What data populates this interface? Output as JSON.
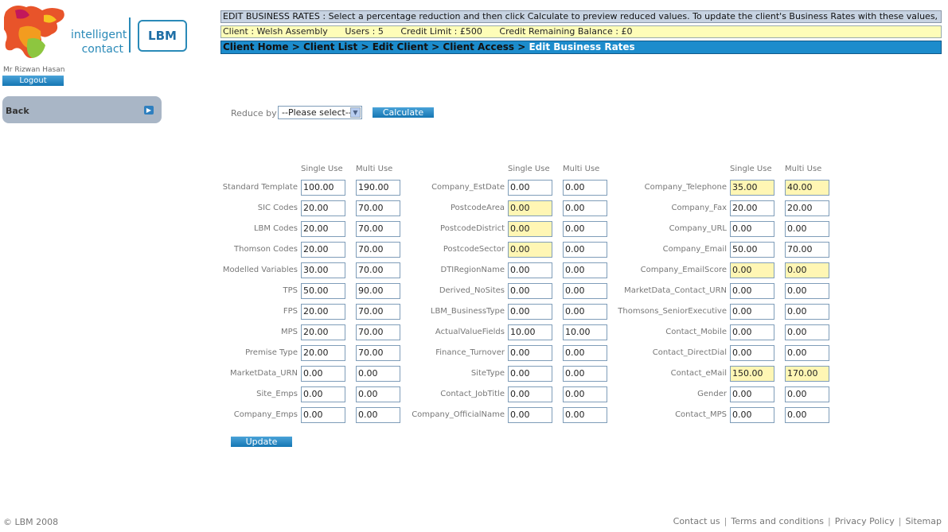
{
  "brand": {
    "logo_text": "intelligent contact",
    "logo_line1": "intelligent",
    "logo_line2": "contact",
    "badge": "LBM"
  },
  "user": {
    "name": "Mr Rizwan Hasan",
    "logout_label": "Logout"
  },
  "nav": {
    "back_label": "Back",
    "back_icon": "arrow-icon"
  },
  "info_bar": {
    "text": "EDIT BUSINESS RATES : Select a percentage reduction and then click Calculate to preview reduced values. To update the client's Business Rates with these values, click Update."
  },
  "client_bar": {
    "client": "Client : Welsh Assembly",
    "users": "Users : 5",
    "credit_limit": "Credit Limit : £500",
    "credit_remaining": "Credit Remaining Balance : £0"
  },
  "breadcrumb": {
    "items": [
      "Client Home",
      "Client List",
      "Edit Client",
      "Client Access"
    ],
    "current": "Edit Business Rates",
    "separator": ">"
  },
  "reduce": {
    "label": "Reduce by :",
    "selected": "--Please select--",
    "calculate_label": "Calculate"
  },
  "headers": {
    "single": "Single Use",
    "multi": "Multi Use"
  },
  "columns": [
    {
      "rows": [
        {
          "label": "Standard Template",
          "single": "100.00",
          "multi": "190.00",
          "hl": false
        },
        {
          "label": "SIC Codes",
          "single": "20.00",
          "multi": "70.00",
          "hl": false
        },
        {
          "label": "LBM Codes",
          "single": "20.00",
          "multi": "70.00",
          "hl": false
        },
        {
          "label": "Thomson Codes",
          "single": "20.00",
          "multi": "70.00",
          "hl": false
        },
        {
          "label": "Modelled Variables",
          "single": "30.00",
          "multi": "70.00",
          "hl": false
        },
        {
          "label": "TPS",
          "single": "50.00",
          "multi": "90.00",
          "hl": false
        },
        {
          "label": "FPS",
          "single": "20.00",
          "multi": "70.00",
          "hl": false
        },
        {
          "label": "MPS",
          "single": "20.00",
          "multi": "70.00",
          "hl": false
        },
        {
          "label": "Premise Type",
          "single": "20.00",
          "multi": "70.00",
          "hl": false
        },
        {
          "label": "MarketData_URN",
          "single": "0.00",
          "multi": "0.00",
          "hl": false
        },
        {
          "label": "Site_Emps",
          "single": "0.00",
          "multi": "0.00",
          "hl": false
        },
        {
          "label": "Company_Emps",
          "single": "0.00",
          "multi": "0.00",
          "hl": false
        }
      ]
    },
    {
      "rows": [
        {
          "label": "Company_EstDate",
          "single": "0.00",
          "multi": "0.00",
          "hl": false
        },
        {
          "label": "PostcodeArea",
          "single": "0.00",
          "multi": "0.00",
          "hl": true,
          "hl_multi": false
        },
        {
          "label": "PostcodeDistrict",
          "single": "0.00",
          "multi": "0.00",
          "hl": true,
          "hl_multi": false
        },
        {
          "label": "PostcodeSector",
          "single": "0.00",
          "multi": "0.00",
          "hl": true,
          "hl_multi": false
        },
        {
          "label": "DTIRegionName",
          "single": "0.00",
          "multi": "0.00",
          "hl": false
        },
        {
          "label": "Derived_NoSites",
          "single": "0.00",
          "multi": "0.00",
          "hl": false
        },
        {
          "label": "LBM_BusinessType",
          "single": "0.00",
          "multi": "0.00",
          "hl": false
        },
        {
          "label": "ActualValueFields",
          "single": "10.00",
          "multi": "10.00",
          "hl": false
        },
        {
          "label": "Finance_Turnover",
          "single": "0.00",
          "multi": "0.00",
          "hl": false
        },
        {
          "label": "SiteType",
          "single": "0.00",
          "multi": "0.00",
          "hl": false
        },
        {
          "label": "Contact_JobTitle",
          "single": "0.00",
          "multi": "0.00",
          "hl": false
        },
        {
          "label": "Company_OfficialName",
          "single": "0.00",
          "multi": "0.00",
          "hl": false
        }
      ]
    },
    {
      "rows": [
        {
          "label": "Company_Telephone",
          "single": "35.00",
          "multi": "40.00",
          "hl": true,
          "hl_multi": true
        },
        {
          "label": "Company_Fax",
          "single": "20.00",
          "multi": "20.00",
          "hl": false
        },
        {
          "label": "Company_URL",
          "single": "0.00",
          "multi": "0.00",
          "hl": false
        },
        {
          "label": "Company_Email",
          "single": "50.00",
          "multi": "70.00",
          "hl": false
        },
        {
          "label": "Company_EmailScore",
          "single": "0.00",
          "multi": "0.00",
          "hl": true,
          "hl_multi": true
        },
        {
          "label": "MarketData_Contact_URN",
          "single": "0.00",
          "multi": "0.00",
          "hl": false
        },
        {
          "label": "Thomsons_SeniorExecutive",
          "single": "0.00",
          "multi": "0.00",
          "hl": false
        },
        {
          "label": "Contact_Mobile",
          "single": "0.00",
          "multi": "0.00",
          "hl": false
        },
        {
          "label": "Contact_DirectDial",
          "single": "0.00",
          "multi": "0.00",
          "hl": false
        },
        {
          "label": "Contact_eMail",
          "single": "150.00",
          "multi": "170.00",
          "hl": true,
          "hl_multi": true
        },
        {
          "label": "Gender",
          "single": "0.00",
          "multi": "0.00",
          "hl": false
        },
        {
          "label": "Contact_MPS",
          "single": "0.00",
          "multi": "0.00",
          "hl": false
        }
      ]
    }
  ],
  "update_label": "Update",
  "footer": {
    "copyright": "© LBM 2008",
    "links": [
      "Contact us",
      "Terms and conditions",
      "Privacy Policy",
      "Sitemap"
    ],
    "separator": "|"
  },
  "colors": {
    "accent": "#1c8ccc",
    "highlight": "#fff6b4",
    "info_bar": "#c7d3e2",
    "client_bar": "#fefdb8"
  }
}
